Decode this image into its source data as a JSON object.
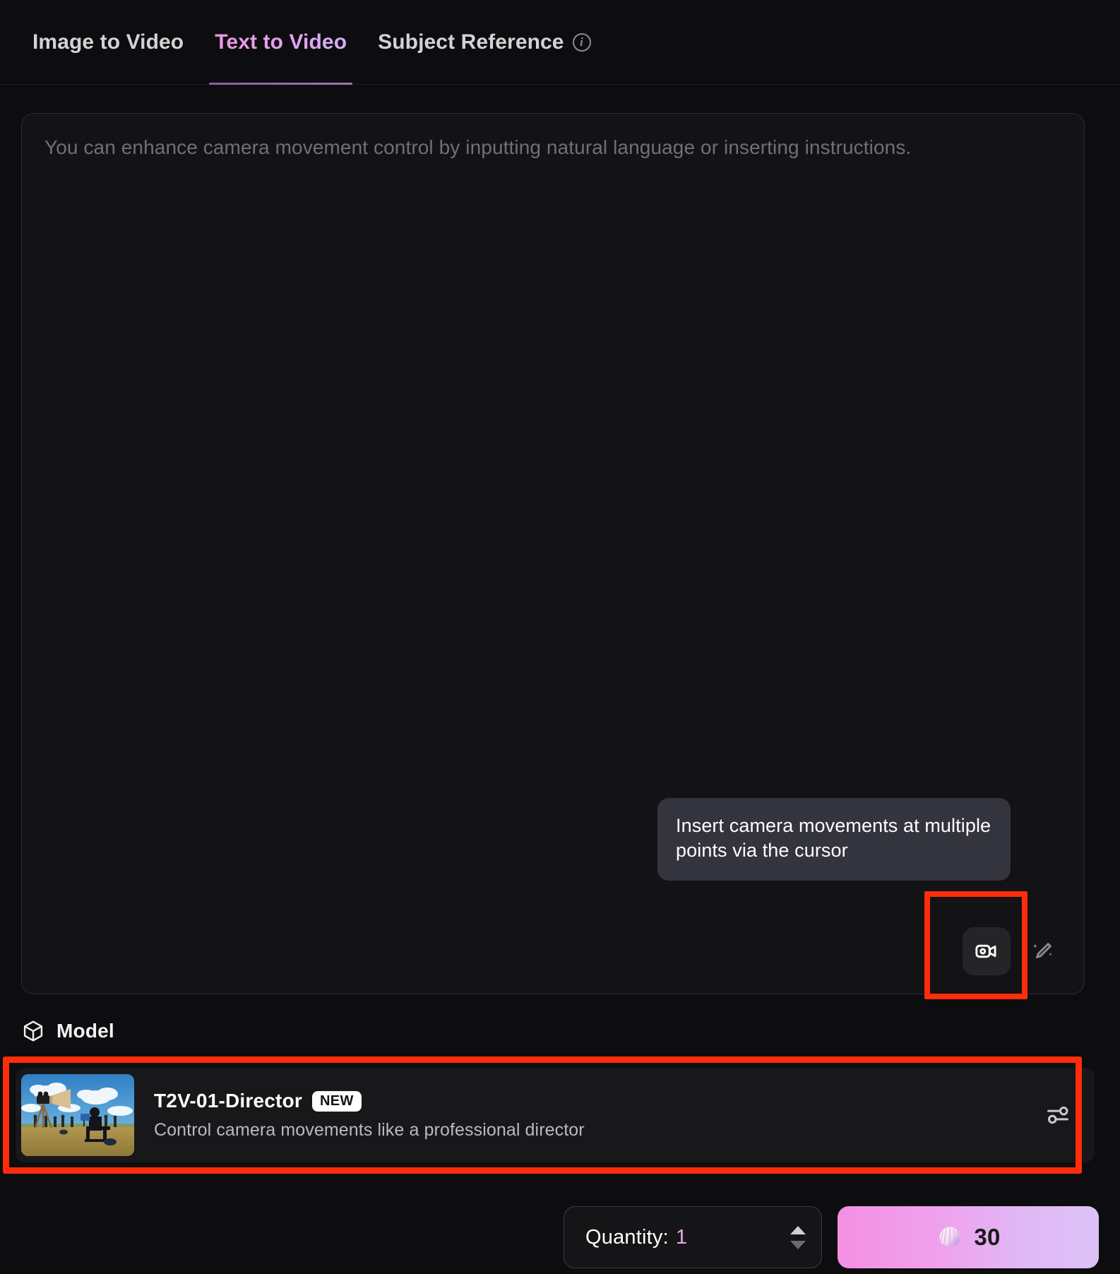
{
  "tabs": [
    {
      "label": "Image to Video",
      "active": false,
      "icon": null
    },
    {
      "label": "Text to Video",
      "active": true,
      "icon": null
    },
    {
      "label": "Subject Reference",
      "active": false,
      "icon": "info-icon"
    }
  ],
  "prompt": {
    "placeholder": "You can enhance camera movement control by inputting natural language or inserting instructions.",
    "value": "",
    "tooltip": "Insert camera movements at multiple points via the cursor",
    "camera_button_icon": "video-camera-icon",
    "enhance_button_icon": "magic-wand-pen-icon"
  },
  "model_section": {
    "header_label": "Model",
    "header_icon": "cube-icon",
    "card": {
      "title": "T2V-01-Director",
      "badge": "NEW",
      "description": "Control camera movements like a professional director",
      "thumbnail_alt": "film-set-thumbnail",
      "settings_icon": "sliders-icon"
    }
  },
  "bottom_bar": {
    "quantity_label": "Quantity:",
    "quantity_value": "1",
    "stepper_up_icon": "chevron-up-icon",
    "stepper_down_icon": "chevron-down-icon",
    "generate_cost": "30",
    "generate_icon": "shell-credit-icon"
  },
  "colors": {
    "background": "#0d0d0f",
    "panel": "#131316",
    "accent_pink": "#f48fe0",
    "accent_lavender": "#cfb3f6",
    "highlight_red": "#ff2d0a",
    "tooltip_bg": "#33343d"
  }
}
